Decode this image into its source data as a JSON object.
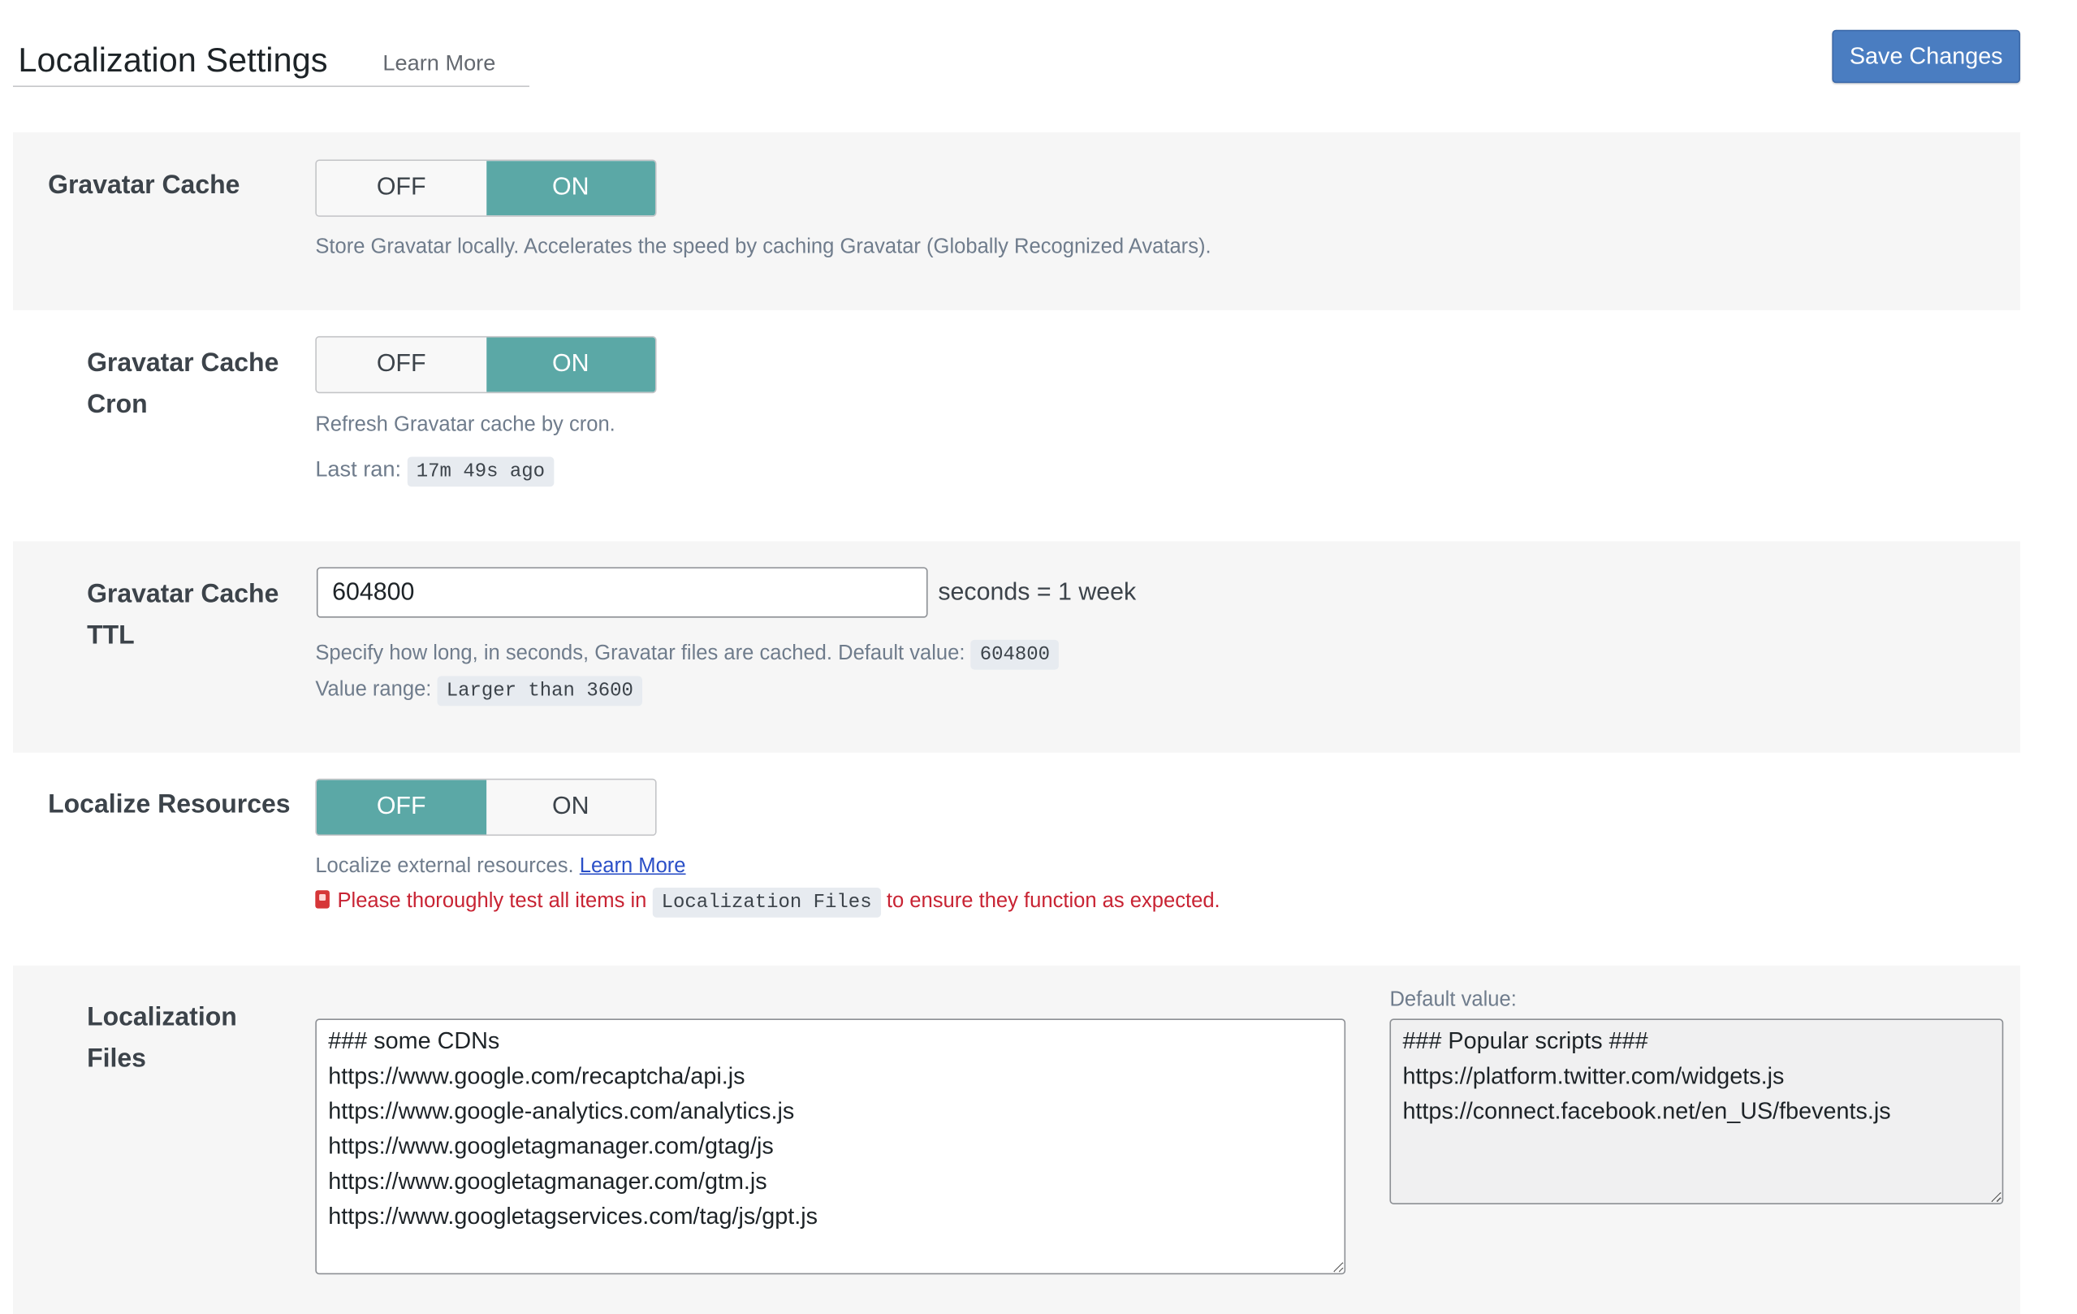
{
  "header": {
    "title": "Localization Settings",
    "learn_more": "Learn More",
    "save_label": "Save Changes"
  },
  "gravatar_cache": {
    "label": "Gravatar Cache",
    "off_label": "OFF",
    "on_label": "ON",
    "value": "ON",
    "description": "Store Gravatar locally. Accelerates the speed by caching Gravatar (Globally Recognized Avatars)."
  },
  "gravatar_cache_cron": {
    "label_line1": "Gravatar Cache",
    "label_line2": "Cron",
    "off_label": "OFF",
    "on_label": "ON",
    "value": "ON",
    "description": "Refresh Gravatar cache by cron.",
    "last_ran_label": "Last ran:",
    "last_ran_value": "17m 49s ago"
  },
  "gravatar_cache_ttl": {
    "label_line1": "Gravatar Cache",
    "label_line2": "TTL",
    "value": "604800",
    "suffix": "seconds = 1 week",
    "description": "Specify how long, in seconds, Gravatar files are cached. Default value:",
    "default_value": "604800",
    "range_label": "Value range:",
    "range_value": "Larger than 3600"
  },
  "localize_resources": {
    "label": "Localize Resources",
    "off_label": "OFF",
    "on_label": "ON",
    "value": "OFF",
    "description": "Localize external resources.",
    "learn_more": "Learn More",
    "warning_prefix": "Please thoroughly test all items in",
    "warning_code": "Localization Files",
    "warning_suffix": "to ensure they function as expected."
  },
  "localization_files": {
    "label_line1": "Localization",
    "label_line2": "Files",
    "lines": [
      "### some CDNs",
      "https://www.google.com/recaptcha/api.js",
      "https://www.google-analytics.com/analytics.js",
      "https://www.googletagmanager.com/gtag/js",
      "https://www.googletagmanager.com/gtm.js",
      "https://www.googletagservices.com/tag/js/gpt.js"
    ],
    "default_label": "Default value:",
    "default_lines": [
      "### Popular scripts ###",
      "https://platform.twitter.com/widgets.js",
      "https://connect.facebook.net/en_US/fbevents.js"
    ]
  },
  "colors": {
    "toggle_active": "#5ba8a6",
    "save_button": "#4a7dc1",
    "warning": "#c82333",
    "link": "#2a4fc7"
  }
}
